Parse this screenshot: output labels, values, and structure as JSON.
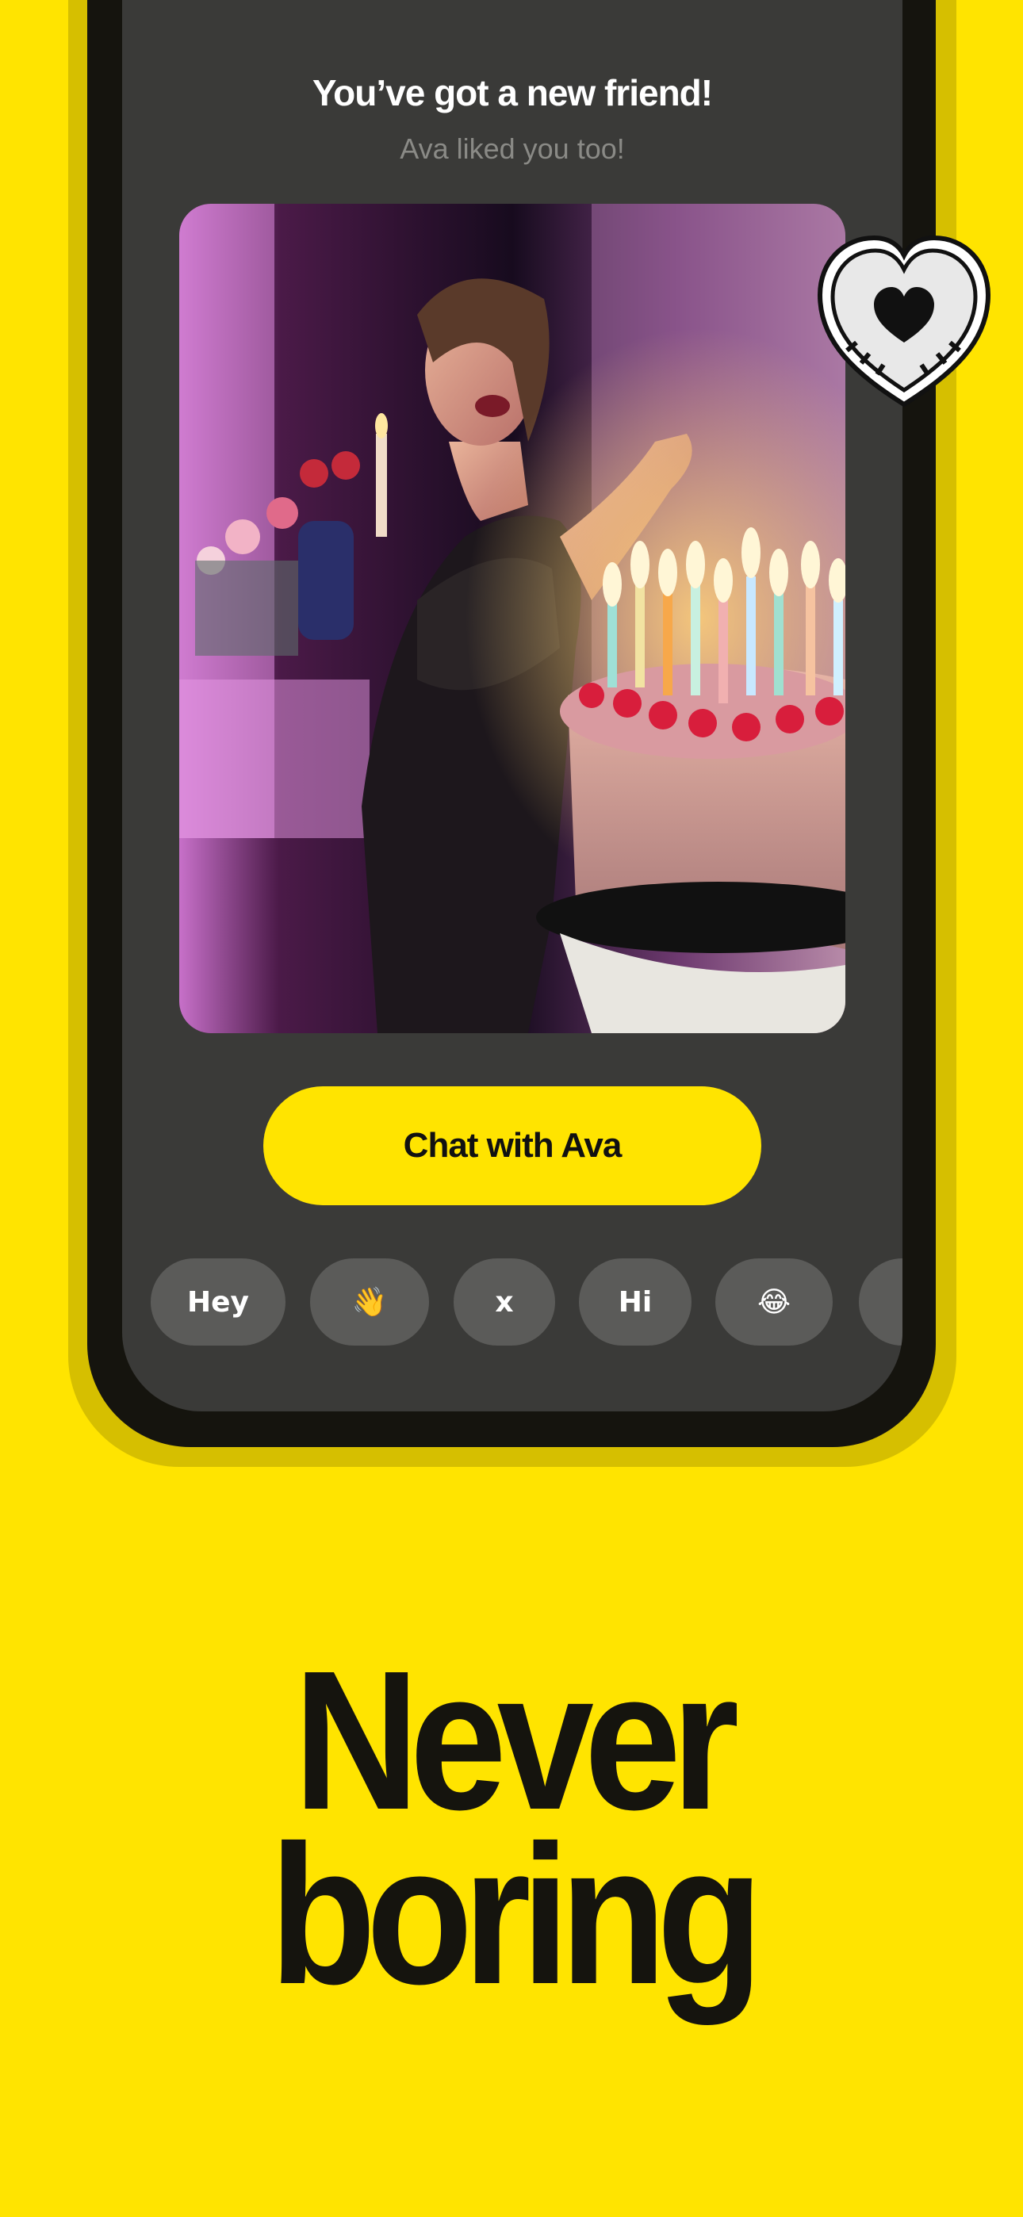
{
  "match": {
    "title": "You’ve got a new friend!",
    "subtitle": "Ava liked you too!"
  },
  "photo": {
    "description_icon": "birthday-cake-photo"
  },
  "chat_button": {
    "label": "Chat with Ava"
  },
  "quick_replies": [
    {
      "label": "Hey"
    },
    {
      "label": "👋"
    },
    {
      "label": "x"
    },
    {
      "label": "Hi"
    },
    {
      "label": "😂"
    },
    {
      "label": ""
    }
  ],
  "sticker": {
    "icon": "heart-icon"
  },
  "headline": {
    "line1": "Never",
    "line2": "boring"
  },
  "colors": {
    "background": "#FFE400",
    "phone_frame": "#15140E",
    "screen": "#3A3A38",
    "chip": "#5B5B59",
    "accent": "#FFE400"
  }
}
